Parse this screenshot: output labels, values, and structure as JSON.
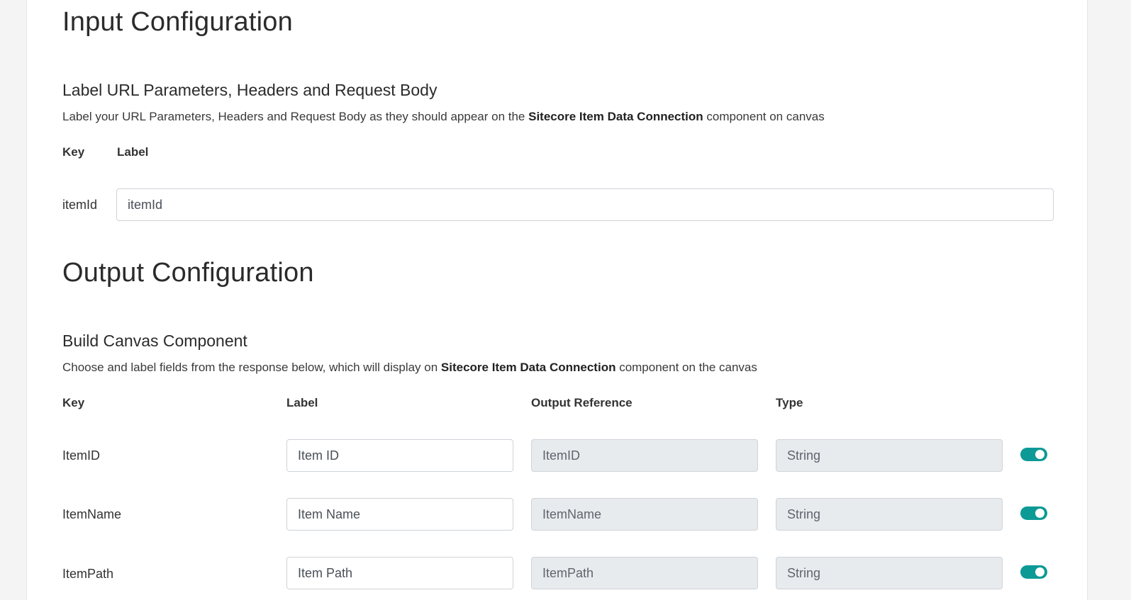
{
  "input_config": {
    "title": "Input Configuration",
    "subtitle": "Label URL Parameters, Headers and Request Body",
    "desc_before": "Label your URL Parameters, Headers and Request Body as they should appear on the ",
    "desc_bold": "Sitecore Item Data Connection",
    "desc_after": " component on canvas",
    "columns": {
      "key": "Key",
      "label": "Label"
    },
    "rows": [
      {
        "key": "itemId",
        "label_value": "itemId"
      }
    ]
  },
  "output_config": {
    "title": "Output Configuration",
    "subtitle": "Build Canvas Component",
    "desc_before": "Choose and label fields from the response below, which will display on ",
    "desc_bold": "Sitecore Item Data Connection",
    "desc_after": " component on the canvas",
    "columns": {
      "key": "Key",
      "label": "Label",
      "output_reference": "Output Reference",
      "type": "Type"
    },
    "rows": [
      {
        "key": "ItemID",
        "label_value": "Item ID",
        "output_reference": "ItemID",
        "type": "String",
        "enabled": true
      },
      {
        "key": "ItemName",
        "label_value": "Item Name",
        "output_reference": "ItemName",
        "type": "String",
        "enabled": true
      },
      {
        "key": "ItemPath",
        "label_value": "Item Path",
        "output_reference": "ItemPath",
        "type": "String",
        "enabled": true
      }
    ]
  },
  "colors": {
    "toggle_on": "#0d9a96",
    "readonly_bg": "#e8ebee"
  }
}
